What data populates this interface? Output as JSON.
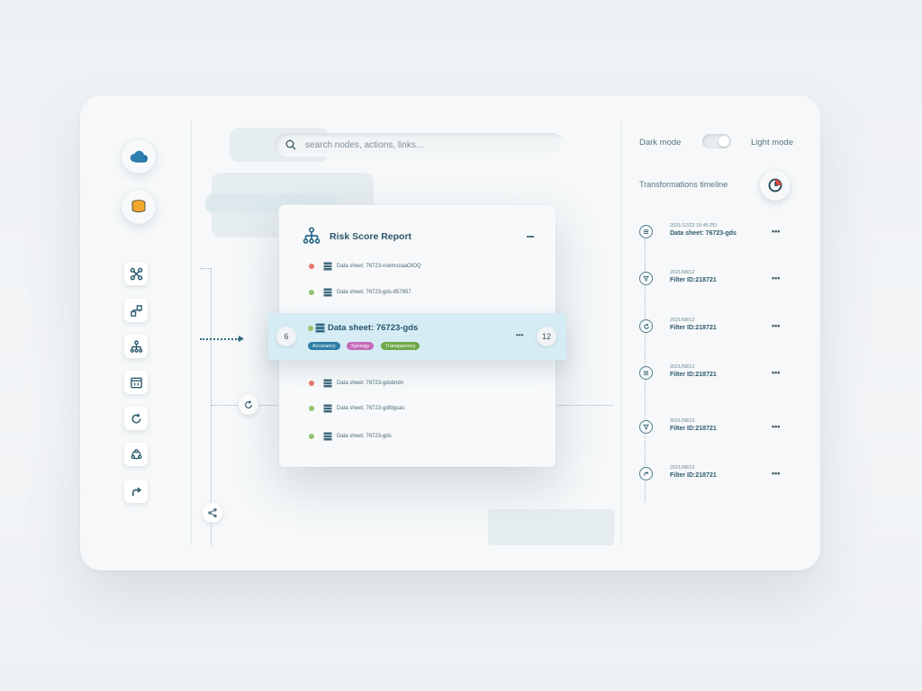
{
  "search": {
    "placeholder": "search nodes, actions, links..."
  },
  "report": {
    "title": "Risk Score Report",
    "rows_top": [
      {
        "label": "Data sheet: 76723-nskmvzaaOIOQ",
        "status": "red"
      },
      {
        "label": "Data sheet: 76723-gds-857857",
        "status": "green"
      }
    ],
    "selected": {
      "label": "Data sheet: 76723-gds",
      "status": "green",
      "left_count": "6",
      "right_count": "12",
      "more": "•••",
      "tags": [
        {
          "label": "Accurancy",
          "color": "#2d7fa6"
        },
        {
          "label": "Synergy",
          "color": "#c56bb8"
        },
        {
          "label": "Transparency",
          "color": "#6fa84a"
        }
      ]
    },
    "rows_bottom": [
      {
        "label": "Data sheet: 76723-gdsbndn",
        "status": "red"
      },
      {
        "label": "Data sheet: 76723-gdfdgsas",
        "status": "green"
      },
      {
        "label": "Data sheet: 76723-gds",
        "status": "green"
      }
    ]
  },
  "theme": {
    "dark_label": "Dark mode",
    "light_label": "Light mode"
  },
  "timeline": {
    "title": "Transformations timeline",
    "items": [
      {
        "date": "2021/12/22 16:45 PD",
        "label": "Data sheet: 76723-gds",
        "icon": "list-icon",
        "more": "•••"
      },
      {
        "date": "2021/08/12",
        "label": "Filter ID:218721",
        "icon": "filter-icon",
        "more": "•••"
      },
      {
        "date": "2021/08/12",
        "label": "Filter ID:218721",
        "icon": "refresh-icon",
        "more": "•••"
      },
      {
        "date": "2021/08/12",
        "label": "Filter ID:218721",
        "icon": "list-icon",
        "more": "•••"
      },
      {
        "date": "2021/08/12",
        "label": "Filter ID:218721",
        "icon": "filter-icon",
        "more": "•••"
      },
      {
        "date": "2021/08/12",
        "label": "Filter ID:218721",
        "icon": "redo-icon",
        "more": "•••"
      }
    ]
  },
  "colors": {
    "accent": "#2c6e8a",
    "selected_row": "#d6ecf4",
    "status_red": "#e9746c",
    "status_green": "#95c36d",
    "database_orange": "#f2a72b"
  }
}
